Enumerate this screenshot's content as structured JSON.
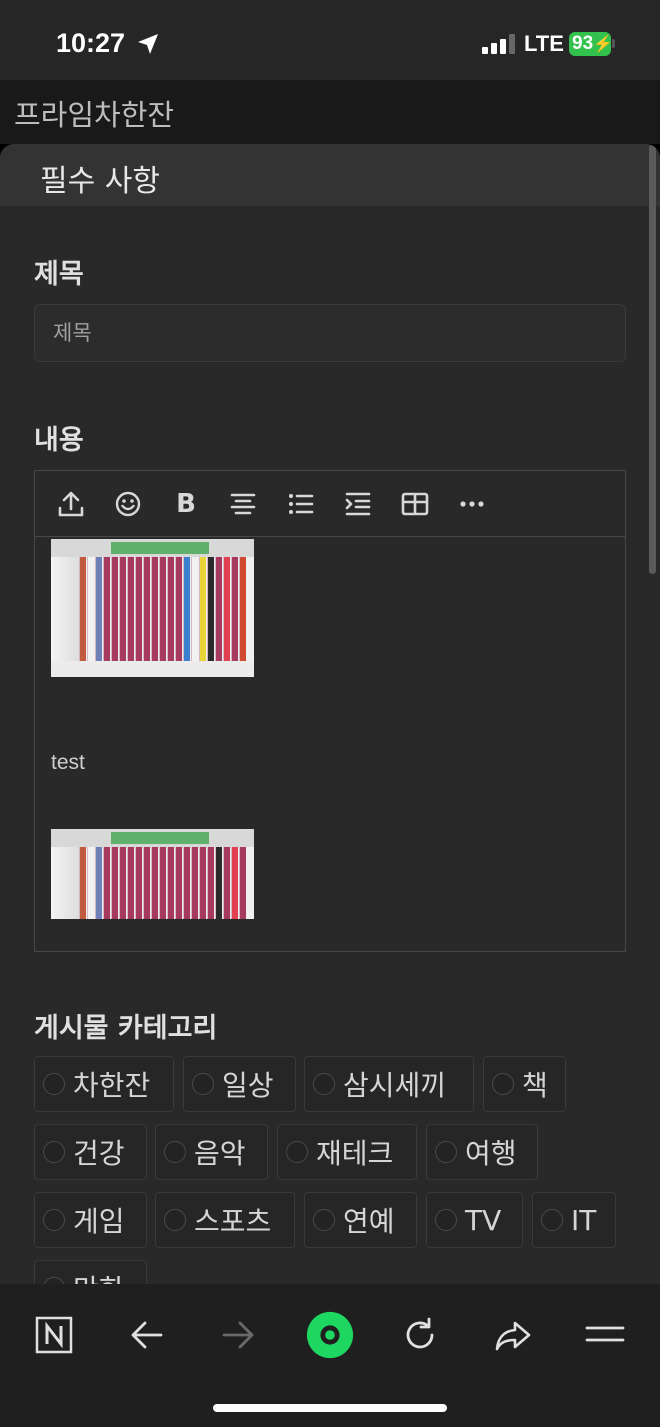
{
  "status_bar": {
    "time": "10:27",
    "network": "LTE",
    "battery": "93"
  },
  "site": {
    "title": "프라임차한잔"
  },
  "sheet": {
    "title": "필수 사항"
  },
  "form": {
    "title_label": "제목",
    "title_placeholder": "제목",
    "content_label": "내용",
    "content_text": "test",
    "category_label": "게시물 카테고리",
    "categories": [
      "차한잔",
      "일상",
      "삼시세끼",
      "책",
      "건강",
      "음악",
      "재테크",
      "여행",
      "게임",
      "스포츠",
      "연예",
      "TV",
      "IT",
      "만화"
    ]
  },
  "toolbar_icons": [
    "upload-icon",
    "emoji-icon",
    "bold-icon",
    "align-center-icon",
    "bullet-list-icon",
    "indent-icon",
    "table-icon",
    "more-icon"
  ],
  "bottom_nav_icons": [
    "naver-n-icon",
    "back-icon",
    "forward-icon",
    "green-dot-icon",
    "reload-icon",
    "share-icon",
    "menu-icon"
  ],
  "colors": {
    "accent_green": "#1ed760",
    "battery_green": "#33c24d",
    "background": "#292929"
  }
}
